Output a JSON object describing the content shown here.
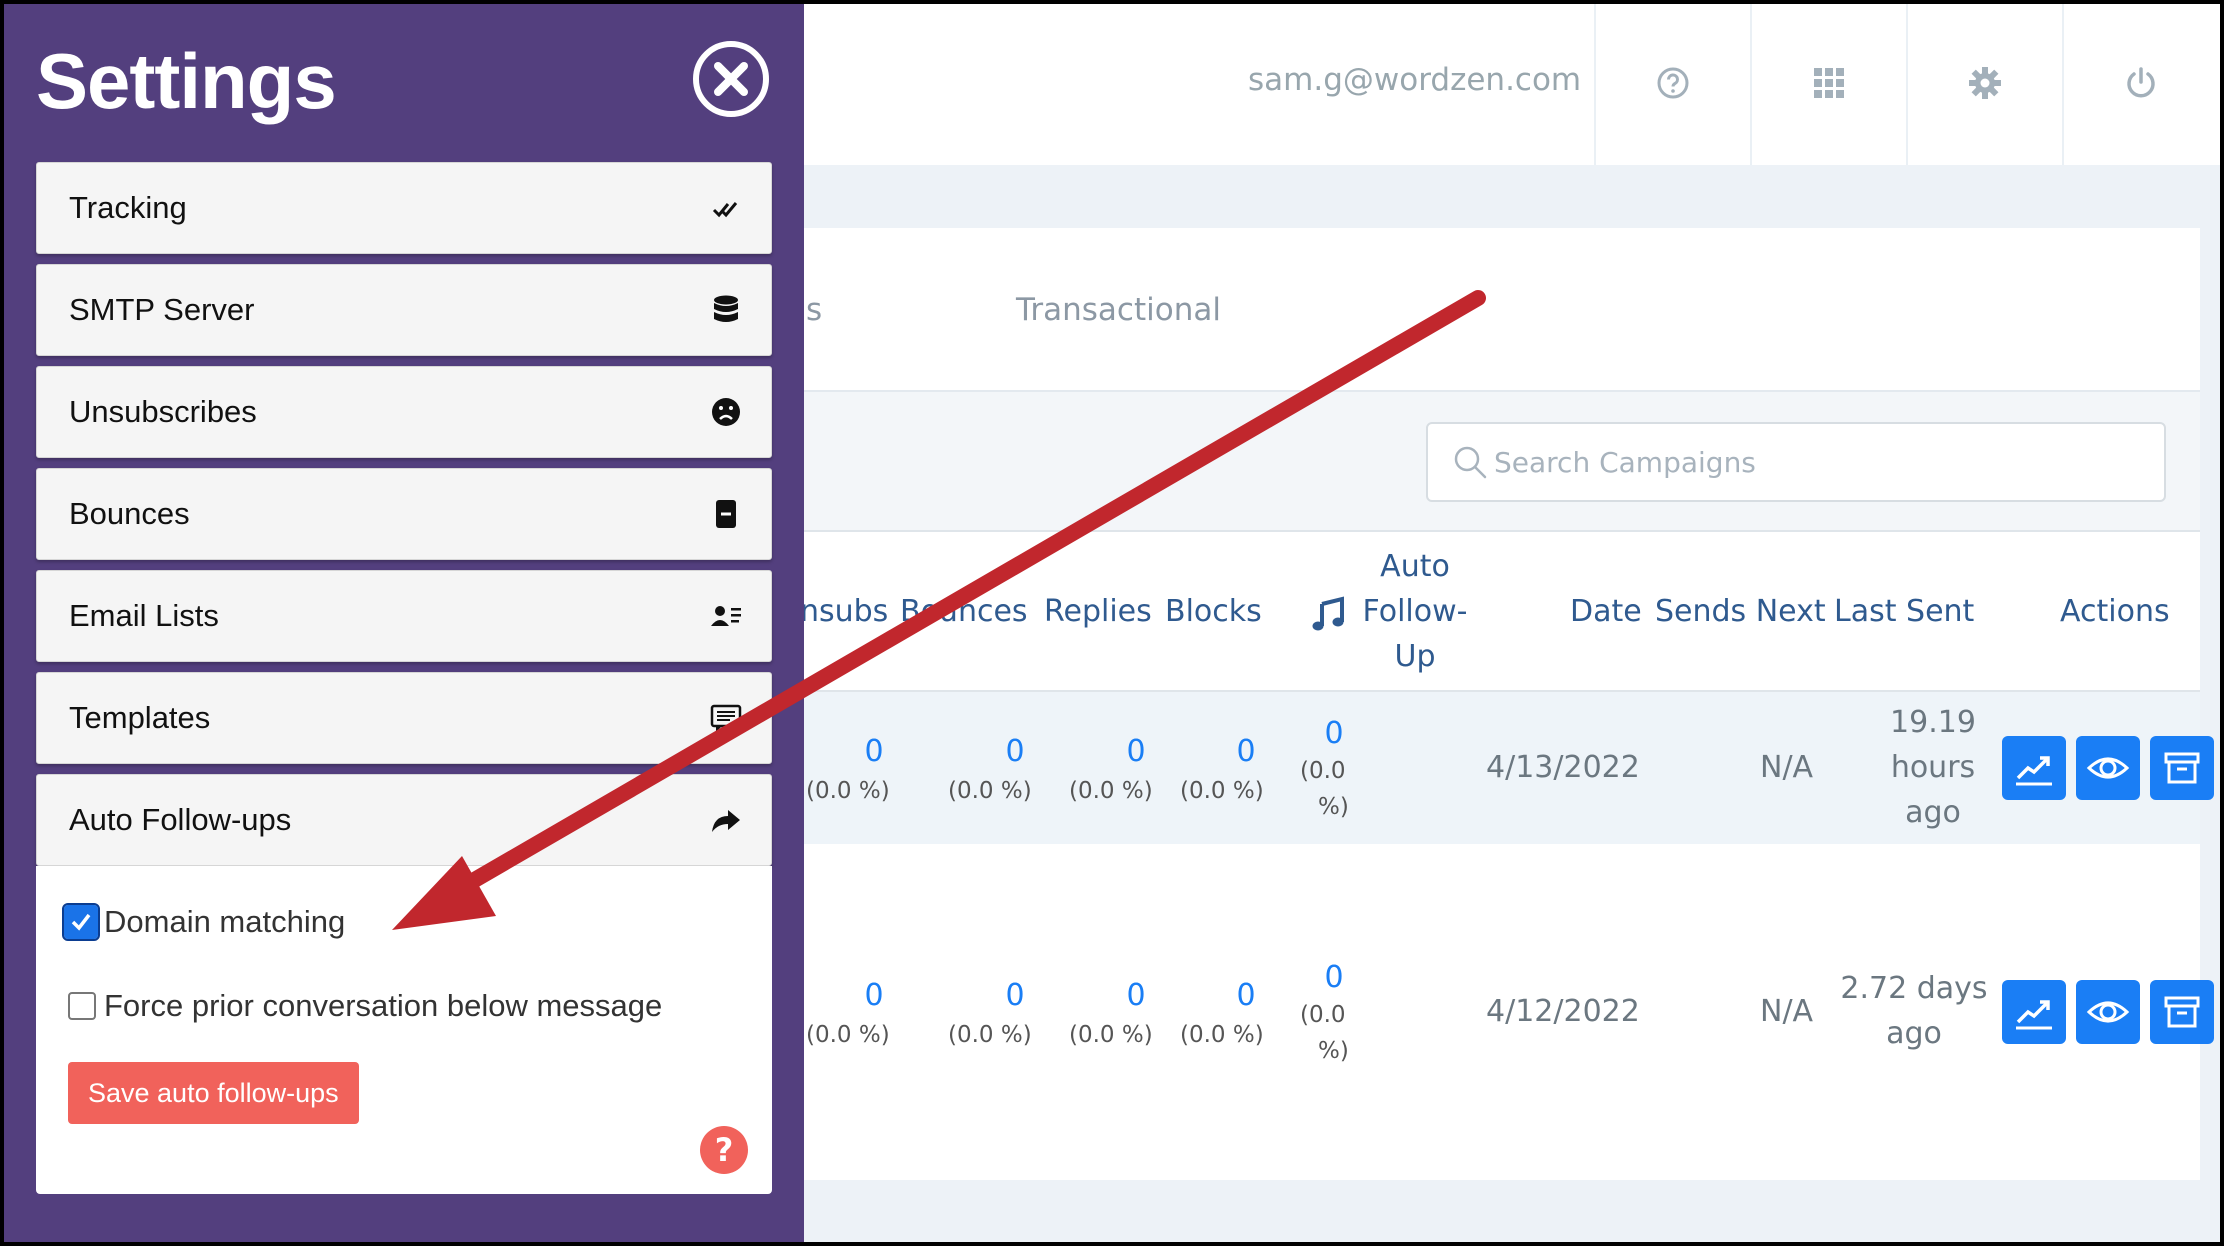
{
  "panel": {
    "title": "Settings",
    "menu": [
      {
        "label": "Tracking",
        "icon": "double-check-icon"
      },
      {
        "label": "SMTP Server",
        "icon": "database-icon"
      },
      {
        "label": "Unsubscribes",
        "icon": "sad-face-icon"
      },
      {
        "label": "Bounces",
        "icon": "minus-square-icon"
      },
      {
        "label": "Email Lists",
        "icon": "contact-list-icon"
      },
      {
        "label": "Templates",
        "icon": "message-icon"
      },
      {
        "label": "Auto Follow-ups",
        "icon": "share-arrow-icon"
      }
    ],
    "options": {
      "domain_matching": {
        "label": "Domain matching",
        "checked": true
      },
      "force_prior": {
        "label": "Force prior conversation below message",
        "checked": false
      }
    },
    "save_label": "Save auto follow-ups",
    "help_label": "?"
  },
  "topbar": {
    "email": "sam.g@wordzen.com",
    "icons": [
      "help-icon",
      "apps-grid-icon",
      "gear-icon",
      "power-icon"
    ]
  },
  "tabs": [
    "igns",
    "Transactional"
  ],
  "search": {
    "placeholder": "Search Campaigns"
  },
  "table": {
    "headers": {
      "unsubs": "Unsubs",
      "bounces": "Bounces",
      "replies": "Replies",
      "blocks": "Blocks",
      "auto_line1": "Auto",
      "auto_line2": "Follow-",
      "auto_line3": "Up",
      "date": "Date",
      "sends_next": "Sends Next",
      "last_sent": "Last Sent",
      "actions": "Actions"
    },
    "rows": [
      {
        "unsubs": "0",
        "unsubs_pct": "(0.0 %)",
        "bounces": "0",
        "bounces_pct": "(0.0 %)",
        "replies": "0",
        "replies_pct": "(0.0 %)",
        "blocks": "0",
        "blocks_pct": "(0.0 %)",
        "auto": "0",
        "auto_pct_1": "(0.0",
        "auto_pct_2": "%)",
        "date": "4/13/2022",
        "sends_next": "N/A",
        "last_sent_1": "19.19",
        "last_sent_2": "hours",
        "last_sent_3": "ago"
      },
      {
        "unsubs": "0",
        "unsubs_pct": "(0.0 %)",
        "bounces": "0",
        "bounces_pct": "(0.0 %)",
        "replies": "0",
        "replies_pct": "(0.0 %)",
        "blocks": "0",
        "blocks_pct": "(0.0 %)",
        "auto": "0",
        "auto_pct_1": "(0.0",
        "auto_pct_2": "%)",
        "date": "4/12/2022",
        "sends_next": "N/A",
        "last_sent_1": "2.72 days",
        "last_sent_2": "ago"
      }
    ]
  },
  "colors": {
    "panel_bg": "#533f7e",
    "accent_blue": "#1a7ef5",
    "save_button": "#f1625b",
    "annotation_arrow": "#c1272d"
  }
}
